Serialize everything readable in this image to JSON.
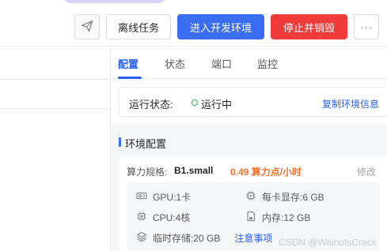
{
  "toolbar": {
    "icon_name": "send-icon",
    "offline_label": "离线任务",
    "dev_label": "进入开发环境",
    "stop_label": "停止并销毁",
    "more_label": "···"
  },
  "tabs": [
    {
      "label": "配置",
      "active": true
    },
    {
      "label": "状态",
      "active": false
    },
    {
      "label": "端口",
      "active": false
    },
    {
      "label": "监控",
      "active": false
    }
  ],
  "status": {
    "label": "运行状态:",
    "value": "运行中",
    "copy_link": "复制环境信息"
  },
  "section": {
    "title": "环境配置"
  },
  "config": {
    "spec_label": "算力规格:",
    "spec_value": "B1.small",
    "spec_price": "0.49 算力点/小时",
    "edit_label": "修改",
    "resources": {
      "gpu": "GPU:1卡",
      "vram": "每卡显存:6 GB",
      "cpu": "CPU:4核",
      "memory": "内存:12 GB",
      "storage": "临时存储:20 GB",
      "notice_link": "注意事项"
    }
  },
  "watermark": "CSDN @WalnutsCrack"
}
